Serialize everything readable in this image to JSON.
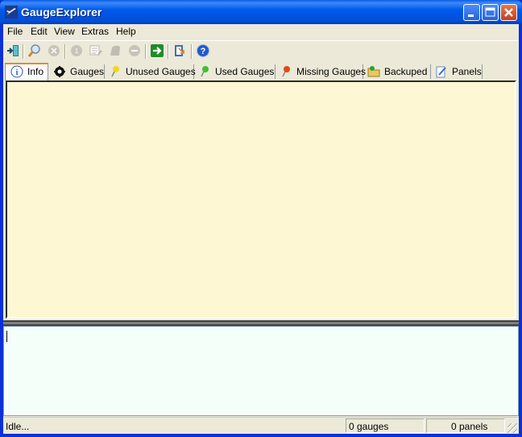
{
  "window": {
    "title": "GaugeExplorer",
    "controls": [
      "minimize",
      "maximize",
      "close"
    ]
  },
  "menubar": {
    "items": [
      "File",
      "Edit",
      "View",
      "Extras",
      "Help"
    ]
  },
  "toolbar": {
    "buttons": [
      {
        "icon": "exit-icon",
        "enabled": true
      },
      {
        "icon": "search-icon",
        "enabled": true
      },
      {
        "icon": "cancel-icon",
        "enabled": false
      },
      {
        "icon": "gauge-icon",
        "enabled": false
      },
      {
        "icon": "edit-list-icon",
        "enabled": false
      },
      {
        "icon": "panel-icon",
        "enabled": false
      },
      {
        "icon": "remove-icon",
        "enabled": false
      },
      {
        "icon": "go-arrow-icon",
        "enabled": true
      },
      {
        "icon": "export-icon",
        "enabled": true
      },
      {
        "icon": "help-icon",
        "enabled": true
      }
    ]
  },
  "tabs": [
    {
      "label": "Info",
      "icon": "info-icon",
      "active": true
    },
    {
      "label": "Gauges",
      "icon": "gauge-icon",
      "active": false
    },
    {
      "label": "Unused Gauges",
      "icon": "yellow-pin-icon",
      "active": false
    },
    {
      "label": "Used Gauges",
      "icon": "green-pin-icon",
      "active": false
    },
    {
      "label": "Missing Gauges",
      "icon": "red-pin-icon",
      "active": false
    },
    {
      "label": "Backuped",
      "icon": "folder-icon",
      "active": false
    },
    {
      "label": "Panels",
      "icon": "notepad-icon",
      "active": false
    }
  ],
  "log": {
    "value": ""
  },
  "statusbar": {
    "status": "Idle...",
    "gauges": "0 gauges",
    "panels": "0 panels"
  },
  "colors": {
    "titlebar": "#0058ee",
    "info_bg": "#fdf8d3",
    "log_bg": "#f5fff9",
    "tab_accent": "#e68b2c"
  }
}
